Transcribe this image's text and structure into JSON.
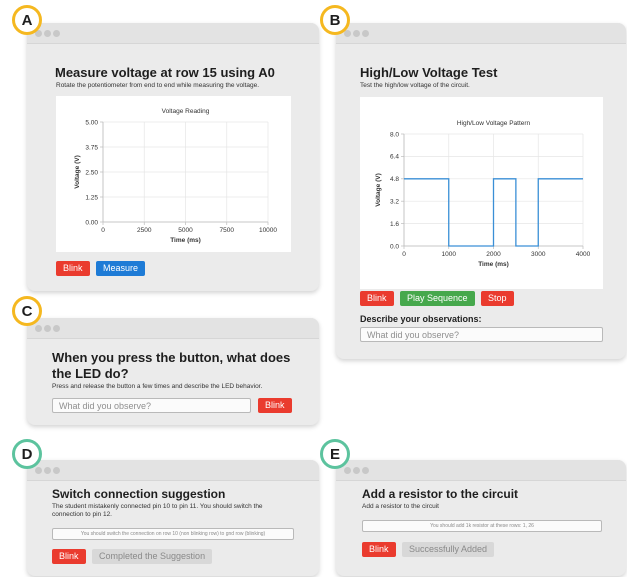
{
  "badges": {
    "a": "A",
    "b": "B",
    "c": "C",
    "d": "D",
    "e": "E"
  },
  "colors": {
    "red": "#ea3b2e",
    "blue": "#1e7bd6",
    "green": "#46a84c",
    "yellow_badge": "#f5b820",
    "green_badge": "#5cc39e",
    "line": "#3a8fd6"
  },
  "panel_a": {
    "title": "Measure voltage at row 15 using A0",
    "subtitle": "Rotate the potentiometer from end to end while measuring the voltage.",
    "blink_label": "Blink",
    "measure_label": "Measure"
  },
  "panel_b": {
    "title": "High/Low Voltage Test",
    "subtitle": "Test the high/low voltage of the circuit.",
    "blink_label": "Blink",
    "play_label": "Play Sequence",
    "stop_label": "Stop",
    "observations_label": "Describe your observations:",
    "observations_placeholder": "What did you observe?"
  },
  "panel_c": {
    "title_line1": "When you press the button, what does",
    "title_line2": "the LED do?",
    "subtitle": "Press and release the button a few times and describe the LED behavior.",
    "input_placeholder": "What did you observe?",
    "blink_label": "Blink"
  },
  "panel_d": {
    "title": "Switch connection suggestion",
    "subtitle_line1": "The student mistakenly connected pin 10 to pin 11. You should switch the",
    "subtitle_line2": "connection to pin 12.",
    "suggestion_text": "You should switch the connection on row 10 (non blinking row) to gnd row (blinking)",
    "blink_label": "Blink",
    "completed_label": "Completed the Suggestion"
  },
  "panel_e": {
    "title": "Add a resistor to the circuit",
    "subtitle": "Add a resistor to the circuit",
    "suggestion_text": "You should add 1k resistor at these rows: 1, 26",
    "blink_label": "Blink",
    "added_label": "Successfully Added"
  },
  "chart_data": [
    {
      "type": "line",
      "title": "Voltage Reading",
      "xlabel": "Time (ms)",
      "ylabel": "Voltage (V)",
      "xlim": [
        0,
        10000
      ],
      "ylim": [
        0,
        5
      ],
      "x_ticks": [
        "0",
        "2500",
        "5000",
        "7500",
        "10000"
      ],
      "y_ticks": [
        "0.00",
        "1.25",
        "2.50",
        "3.75",
        "5.00"
      ],
      "grid": true,
      "series": []
    },
    {
      "type": "line",
      "title": "High/Low Voltage Pattern",
      "xlabel": "Time (ms)",
      "ylabel": "Voltage (V)",
      "xlim": [
        0,
        4000
      ],
      "ylim": [
        0,
        8
      ],
      "x_ticks": [
        "0",
        "1000",
        "2000",
        "3000",
        "4000"
      ],
      "y_ticks": [
        "0.0",
        "1.6",
        "3.2",
        "4.8",
        "6.4",
        "8.0"
      ],
      "grid": true,
      "series": [
        {
          "x": [
            0,
            1000,
            1000,
            2000,
            2000,
            2500,
            2500,
            3000,
            3000,
            4000
          ],
          "y": [
            4.8,
            4.8,
            0,
            0,
            4.8,
            4.8,
            0,
            0,
            4.8,
            4.8
          ]
        }
      ]
    }
  ]
}
